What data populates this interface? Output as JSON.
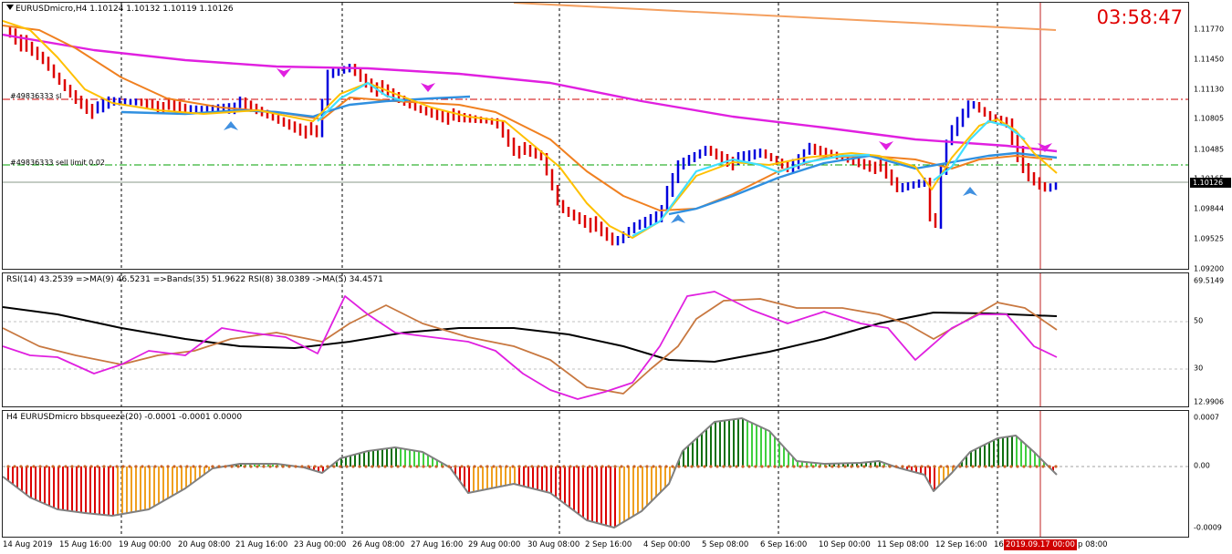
{
  "main": {
    "header": "EURUSDmicro,H4  1.10124 1.10132 1.10119 1.10126",
    "clock": "03:58:47",
    "sl_label": "#49836333 sl",
    "limit_label": "#49836333 sell limit 0.02",
    "y_labels": [
      "1.11770",
      "1.11450",
      "1.11130",
      "1.10805",
      "1.10485",
      "1.10165",
      "1.09844",
      "1.09525",
      "1.09200"
    ],
    "current_price": "1.10126"
  },
  "rsi": {
    "header": "RSI(14) 43.2539  =>MA(9) 46.5231  =>Bands(35) 51.9622  RSI(8) 38.0389  ->MA(5) 34.4571",
    "y_labels": [
      "69.5149",
      "50",
      "30",
      "12.9906"
    ]
  },
  "squeeze": {
    "header": "H4 EURUSDmicro bbsqueeze(20) -0.0001 -0.0001 0.0000",
    "y_labels": [
      "0.0007",
      "0.00",
      "-0.0009"
    ]
  },
  "x_axis": {
    "labels": [
      "14 Aug 2019",
      "15 Aug 16:00",
      "19 Aug 00:00",
      "20 Aug 08:00",
      "21 Aug 16:00",
      "23 Aug 00:00",
      "26 Aug 08:00",
      "27 Aug 16:00",
      "29 Aug 00:00",
      "30 Aug 08:00",
      "2 Sep 16:00",
      "4 Sep 00:00",
      "5 Sep 08:00",
      "6 Sep 16:00",
      "10 Sep 00:00",
      "11 Sep 08:00",
      "12 Sep 16:00",
      "16"
    ],
    "current_time": "2019.09.17 00:00",
    "tail": "p 08:00"
  },
  "colors": {
    "bull": "#0000dd",
    "bear": "#dd0000",
    "ma_yellow": "#ffc000",
    "ma_orange": "#f08020",
    "ma_magenta": "#e020e0",
    "ma_cyan": "#40e0ff",
    "ma_blue": "#3090e0",
    "sl_line": "#d00000",
    "limit_line": "#00a000",
    "rsi_magenta": "#e020e0",
    "rsi_brown": "#c87840",
    "rsi_black": "#000000",
    "sq_red": "#dd0000",
    "sq_orange": "#f0a020",
    "sq_green_dark": "#107010",
    "sq_green_light": "#40d040",
    "sq_outline": "#808080"
  }
}
